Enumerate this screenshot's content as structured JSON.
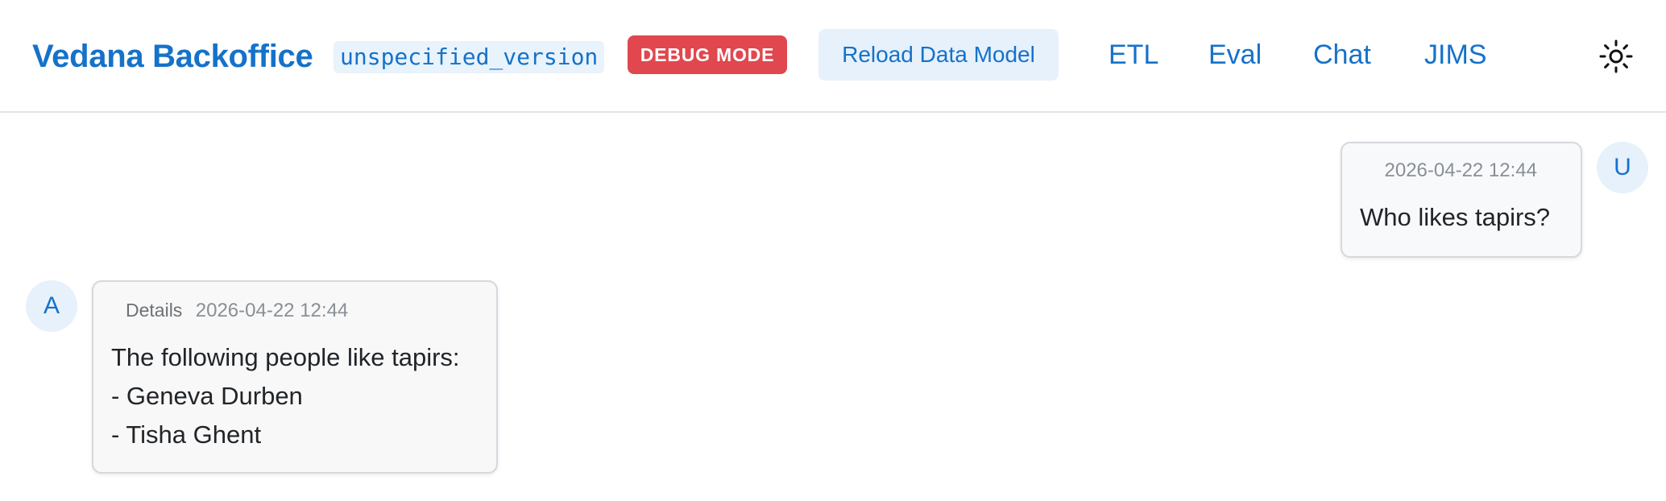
{
  "header": {
    "brand": "Vedana Backoffice",
    "version": "unspecified_version",
    "debug_badge": "DEBUG MODE",
    "reload_button": "Reload Data Model",
    "nav": {
      "etl": "ETL",
      "eval": "Eval",
      "chat": "Chat",
      "jims": "JIMS"
    },
    "theme_icon": "sun-icon"
  },
  "chat": {
    "user_message": {
      "avatar": "U",
      "timestamp": "2026-04-22 12:44",
      "text": "Who likes tapirs?"
    },
    "assistant_message": {
      "avatar": "A",
      "details_label": "Details",
      "timestamp": "2026-04-22 12:44",
      "lines": [
        "The following people like tapirs:",
        "- Geneva Durben",
        "- Tisha Ghent"
      ]
    }
  },
  "colors": {
    "accent": "#1572c9",
    "accent_soft": "#e6f1fb",
    "debug": "#e0474e",
    "bubble_border": "#d5d8de",
    "header_border": "#e3e6ea"
  }
}
